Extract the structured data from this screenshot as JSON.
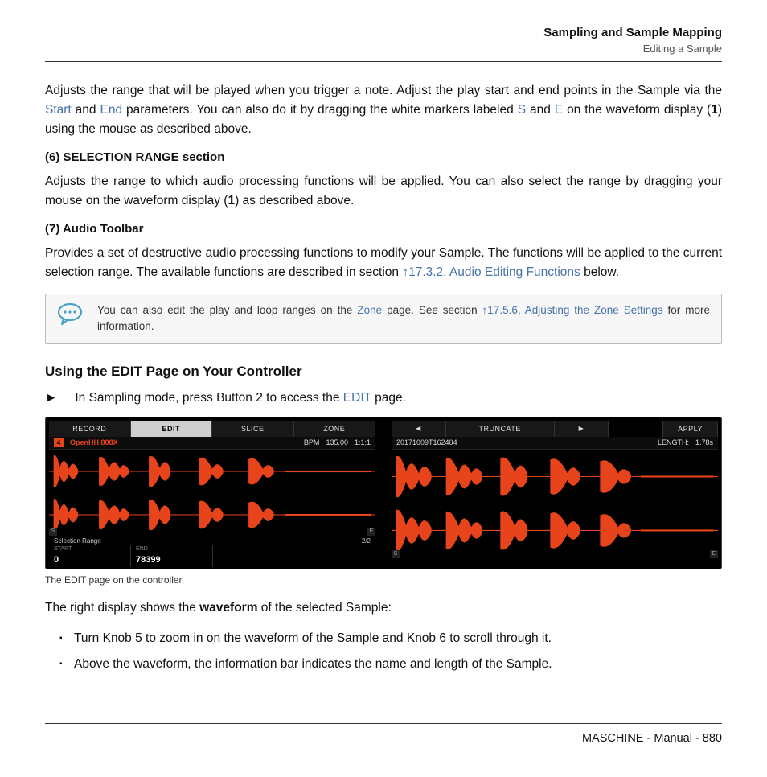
{
  "header": {
    "title": "Sampling and Sample Mapping",
    "subtitle": "Editing a Sample"
  },
  "para1": {
    "pre": "Adjusts the range that will be played when you trigger a note. Adjust the play start and end points in the Sample via the ",
    "start": "Start",
    "mid1": " and ",
    "end": "End",
    "mid2": " parameters. You can also do it by dragging the white markers labeled ",
    "s": "S",
    "mid3": " and ",
    "e": "E",
    "post": " on the waveform display (",
    "one": "1",
    "tail": ") using the mouse as described above."
  },
  "sec6": {
    "heading_pre": "(",
    "heading_num": "6",
    "heading_post": ") SELECTION RANGE section",
    "body_pre": "Adjusts the range to which audio processing functions will be applied. You can also select the range by dragging your mouse on the waveform display (",
    "one": "1",
    "body_post": ") as described above."
  },
  "sec7": {
    "heading_pre": "(",
    "heading_num": "7",
    "heading_post": ") Audio Toolbar",
    "body_pre": "Provides a set of destructive audio processing functions to modify your Sample. The functions will be applied to the current selection range. The available functions are described in section ",
    "link": "↑17.3.2, Audio Editing Functions",
    "body_post": " below."
  },
  "callout": {
    "pre": "You can also edit the play and loop ranges on the ",
    "zone": "Zone",
    "mid": " page. See section ",
    "link": "↑17.5.6, Adjusting the Zone Settings",
    "post": " for more information."
  },
  "h2": "Using the EDIT Page on Your Controller",
  "step1": {
    "arrow": "►",
    "pre": "In Sampling mode, press Button 2 to access the ",
    "edit": "EDIT",
    "post": " page."
  },
  "controller": {
    "left": {
      "tabs": [
        "RECORD",
        "EDIT",
        "SLICE",
        "ZONE"
      ],
      "active_tab": "EDIT",
      "slot_index": "4",
      "sample_name": "OpenHH 808X",
      "bpm_label": "BPM",
      "bpm_value": "135.00",
      "bars": "1:1:1",
      "selection_label": "Selection Range",
      "page_indicator": "2/2",
      "start_label": "START",
      "start_value": "0",
      "end_label": "END",
      "end_value": "78399"
    },
    "right": {
      "nav_prev": "◀",
      "function": "TRUNCATE",
      "nav_next": "▶",
      "apply": "APPLY",
      "timestamp": "20171009T162404",
      "length_label": "LENGTH:",
      "length_value": "1.78s"
    },
    "markers": {
      "s": "S",
      "e": "E"
    }
  },
  "figcaption": "The EDIT page on the controller.",
  "para_after": {
    "pre": "The right display shows the ",
    "bold": "waveform",
    "post": " of the selected Sample:"
  },
  "bullets": [
    "Turn Knob 5 to zoom in on the waveform of the Sample and Knob 6 to scroll through it.",
    "Above the waveform, the information bar indicates the name and length of the Sample."
  ],
  "footer": "MASCHINE - Manual - 880"
}
